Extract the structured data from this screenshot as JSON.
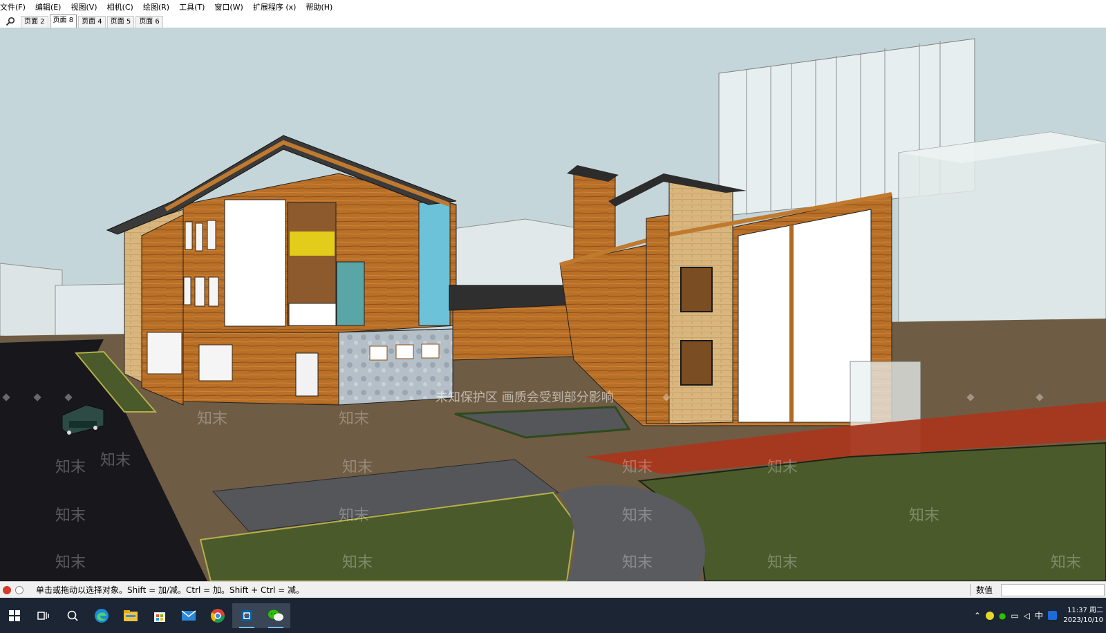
{
  "menu": {
    "items": [
      {
        "id": "file",
        "label": "文件(F)"
      },
      {
        "id": "edit",
        "label": "编辑(E)"
      },
      {
        "id": "view",
        "label": "视图(V)"
      },
      {
        "id": "camera",
        "label": "相机(C)"
      },
      {
        "id": "draw",
        "label": "绘图(R)"
      },
      {
        "id": "tools",
        "label": "工具(T)"
      },
      {
        "id": "window",
        "label": "窗口(W)"
      },
      {
        "id": "extensions",
        "label": "扩展程序 (x)"
      },
      {
        "id": "help",
        "label": "帮助(H)"
      }
    ]
  },
  "scenes": {
    "search_icon": "magnifier-icon",
    "tabs": [
      {
        "label": "页面 2",
        "active": false
      },
      {
        "label": "页面 8",
        "active": true
      },
      {
        "label": "页面 4",
        "active": false
      },
      {
        "label": "页面 5",
        "active": false
      },
      {
        "label": "页面 6",
        "active": false
      }
    ]
  },
  "viewport": {
    "watermark_banner": "未知保护区   画质会受到部分影响",
    "watermark_text": "知末",
    "sky_color": "#c5d6da",
    "ground_color": "#6f5c44",
    "road_color": "#18181c",
    "lawn_color": "#4b5a2b"
  },
  "status": {
    "text": "单击或拖动以选择对象。Shift = 加/减。Ctrl = 加。Shift + Ctrl = 减。",
    "measurements_label": "数值",
    "measurements_value": ""
  },
  "taskbar": {
    "apps": [
      {
        "name": "start-icon"
      },
      {
        "name": "task-view-icon"
      },
      {
        "name": "search-icon"
      },
      {
        "name": "edge-icon"
      },
      {
        "name": "file-explorer-icon"
      },
      {
        "name": "store-icon"
      },
      {
        "name": "mail-icon"
      },
      {
        "name": "chrome-icon"
      },
      {
        "name": "sketchup-icon"
      },
      {
        "name": "wechat-icon"
      }
    ],
    "tray_ime": "中",
    "clock_time": "11:37 周二",
    "clock_date": "2023/10/10"
  }
}
